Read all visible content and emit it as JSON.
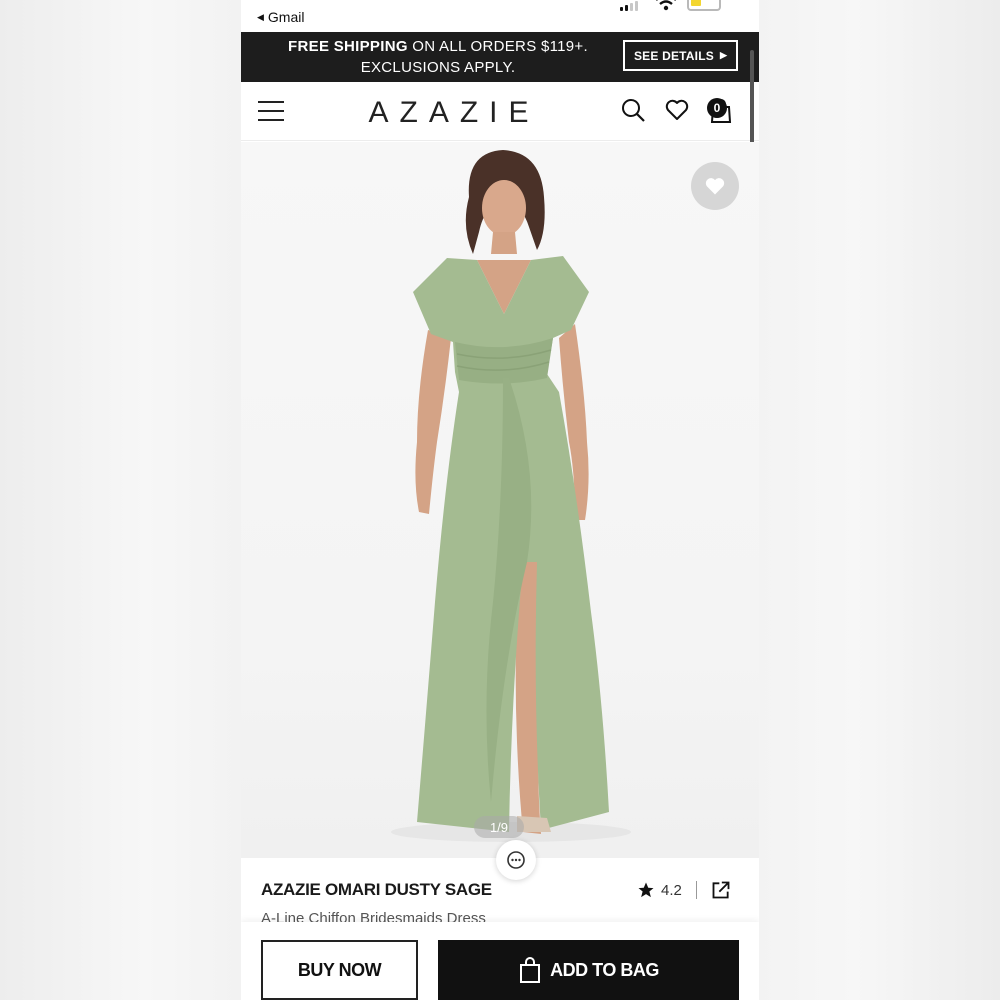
{
  "status_bar": {
    "back_app": "Gmail"
  },
  "promo": {
    "bold": "FREE SHIPPING",
    "rest": "ON ALL ORDERS $119+.",
    "line2": "EXCLUSIONS APPLY.",
    "see_details": "SEE DETAILS"
  },
  "header": {
    "logo": "AZAZIE",
    "bag_count": "0"
  },
  "gallery": {
    "counter": "1/9"
  },
  "product": {
    "title": "AZAZIE OMARI DUSTY SAGE",
    "subtitle": "A-Line Chiffon Bridesmaids Dress",
    "rating": "4.2"
  },
  "actions": {
    "buy_now": "BUY NOW",
    "add_to_bag": "ADD TO BAG"
  },
  "colors": {
    "brand_dark": "#1d1d1d",
    "dress_sage": "#a4bb91"
  }
}
